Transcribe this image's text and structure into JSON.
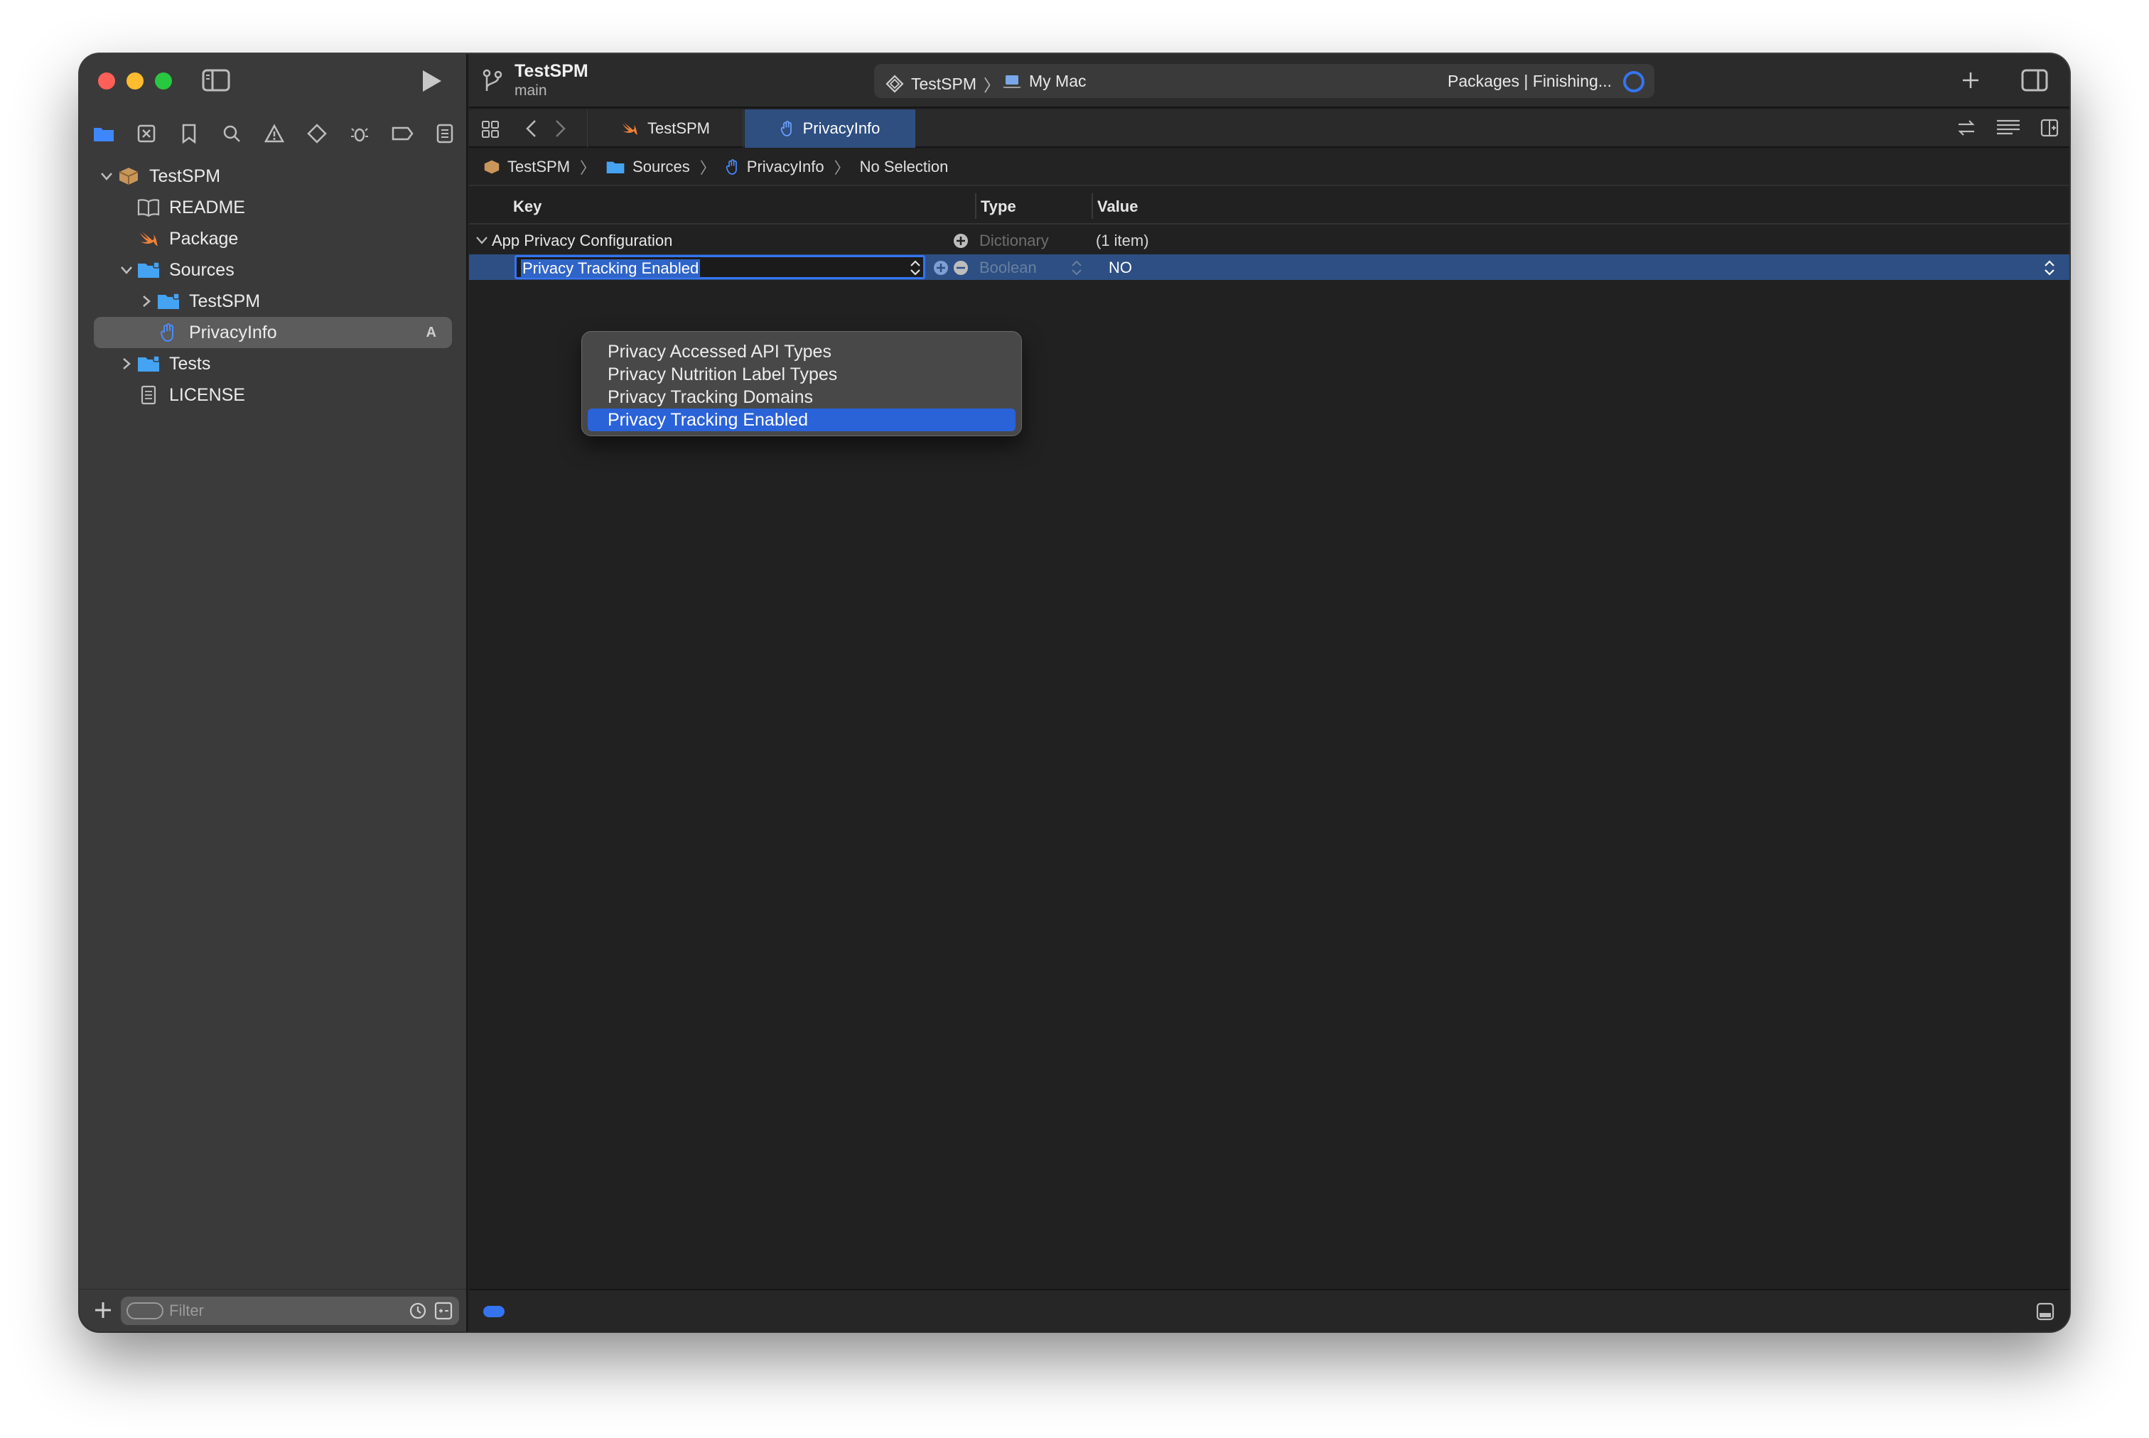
{
  "sidebar": {
    "navigator_icons": [
      "folder-icon",
      "source-control-icon",
      "bookmark-icon",
      "search-icon",
      "warning-icon",
      "test-icon",
      "debug-icon",
      "breakpoint-icon",
      "report-icon"
    ],
    "tree": [
      {
        "label": "TestSPM",
        "icon": "package-icon",
        "level": 0,
        "expanded": true
      },
      {
        "label": "README",
        "icon": "book-icon",
        "level": 1
      },
      {
        "label": "Package",
        "icon": "swift-icon",
        "level": 1
      },
      {
        "label": "Sources",
        "icon": "folder-icon",
        "level": 1,
        "expanded": true
      },
      {
        "label": "TestSPM",
        "icon": "folder-icon",
        "level": 2,
        "expanded": false
      },
      {
        "label": "PrivacyInfo",
        "icon": "privacy-hand-icon",
        "level": 2,
        "selected": true,
        "badge": "A"
      },
      {
        "label": "Tests",
        "icon": "folder-icon",
        "level": 1,
        "expanded": false
      },
      {
        "label": "LICENSE",
        "icon": "document-icon",
        "level": 1
      }
    ],
    "filter_placeholder": "Filter"
  },
  "toolbar": {
    "project_name": "TestSPM",
    "branch": "main",
    "scheme": "TestSPM",
    "destination": "My Mac",
    "status": "Packages | Finishing..."
  },
  "tabs": [
    {
      "label": "TestSPM",
      "icon": "swift-icon",
      "active": false
    },
    {
      "label": "PrivacyInfo",
      "icon": "privacy-hand-icon",
      "active": true
    }
  ],
  "jumpbar": {
    "crumbs": [
      "TestSPM",
      "Sources",
      "PrivacyInfo",
      "No Selection"
    ]
  },
  "plist": {
    "headers": {
      "key": "Key",
      "type": "Type",
      "value": "Value"
    },
    "rows": [
      {
        "key": "App Privacy Configuration",
        "type": "Dictionary",
        "value": "(1 item)"
      },
      {
        "key": "Privacy Tracking Enabled",
        "type": "Boolean",
        "value": "NO"
      }
    ]
  },
  "key_dropdown": {
    "options": [
      "Privacy Accessed API Types",
      "Privacy Nutrition Label Types",
      "Privacy Tracking Domains",
      "Privacy Tracking Enabled"
    ],
    "selected": "Privacy Tracking Enabled"
  },
  "colors": {
    "accent": "#3574f0",
    "selection_row": "#2d4f83",
    "sidebar_bg": "#3a3a3a",
    "editor_bg": "#212121"
  }
}
